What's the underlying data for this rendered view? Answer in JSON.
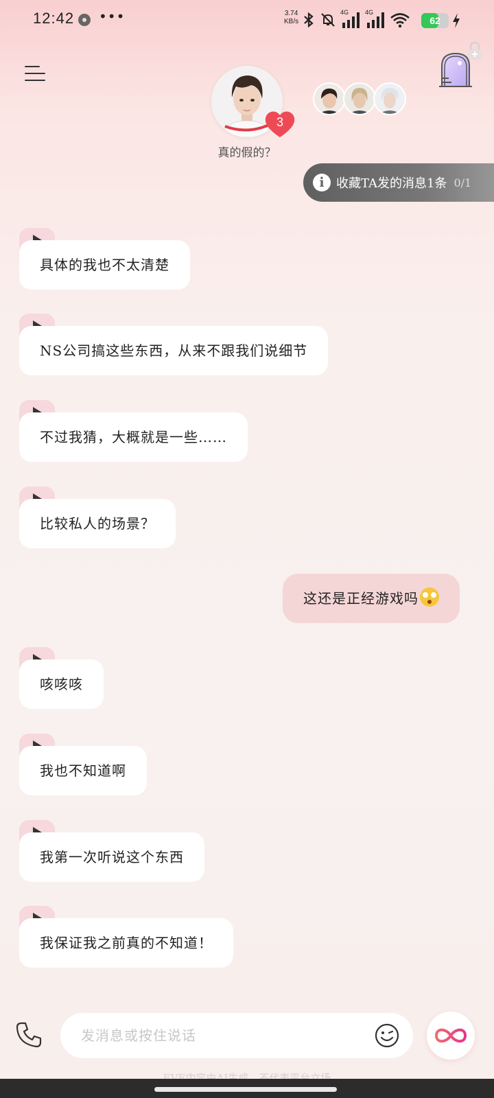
{
  "status_bar": {
    "time": "12:42",
    "more": "•••",
    "net_speed_value": "3.74",
    "net_speed_unit": "KB/s",
    "signal_1_label": "4G",
    "signal_2_label": "4G",
    "battery_level": "62",
    "battery_fraction": 0.62
  },
  "header": {
    "character_name": "真的假的？",
    "heart_count": "3"
  },
  "collect_banner": {
    "text": "收藏TA发的消息1条",
    "count": "0/1"
  },
  "messages": [
    {
      "sender": "character",
      "text": "具体的我也不太清楚"
    },
    {
      "sender": "character",
      "text": "NS公司搞这些东西，从来不跟我们说细节"
    },
    {
      "sender": "character",
      "text": "不过我猜，大概就是一些……"
    },
    {
      "sender": "character",
      "text": "比较私人的场景？"
    },
    {
      "sender": "user",
      "text": "这还是正经游戏吗",
      "emoji": "flushed-face"
    },
    {
      "sender": "character",
      "text": "咳咳咳"
    },
    {
      "sender": "character",
      "text": "我也不知道啊"
    },
    {
      "sender": "character",
      "text": "我第一次听说这个东西"
    },
    {
      "sender": "character",
      "text": "我保证我之前真的不知道！"
    }
  ],
  "input": {
    "placeholder": "发消息或按住说话"
  },
  "footer": {
    "disclaimer": "EVE内容由AI生成，不代表平台立场"
  },
  "colors": {
    "accent_pink": "#f6d8dd",
    "user_bubble": "#f5d6d6",
    "heart_red": "#ee4a55",
    "battery_green": "#34c759"
  },
  "icons": [
    "menu-icon",
    "door-icon",
    "lock-icon",
    "info-icon",
    "play-icon",
    "phone-icon",
    "emoji-icon",
    "infinity-icon",
    "heart-icon",
    "bluetooth-icon",
    "mute-icon",
    "wifi-icon",
    "signal-icon",
    "bolt-icon"
  ]
}
